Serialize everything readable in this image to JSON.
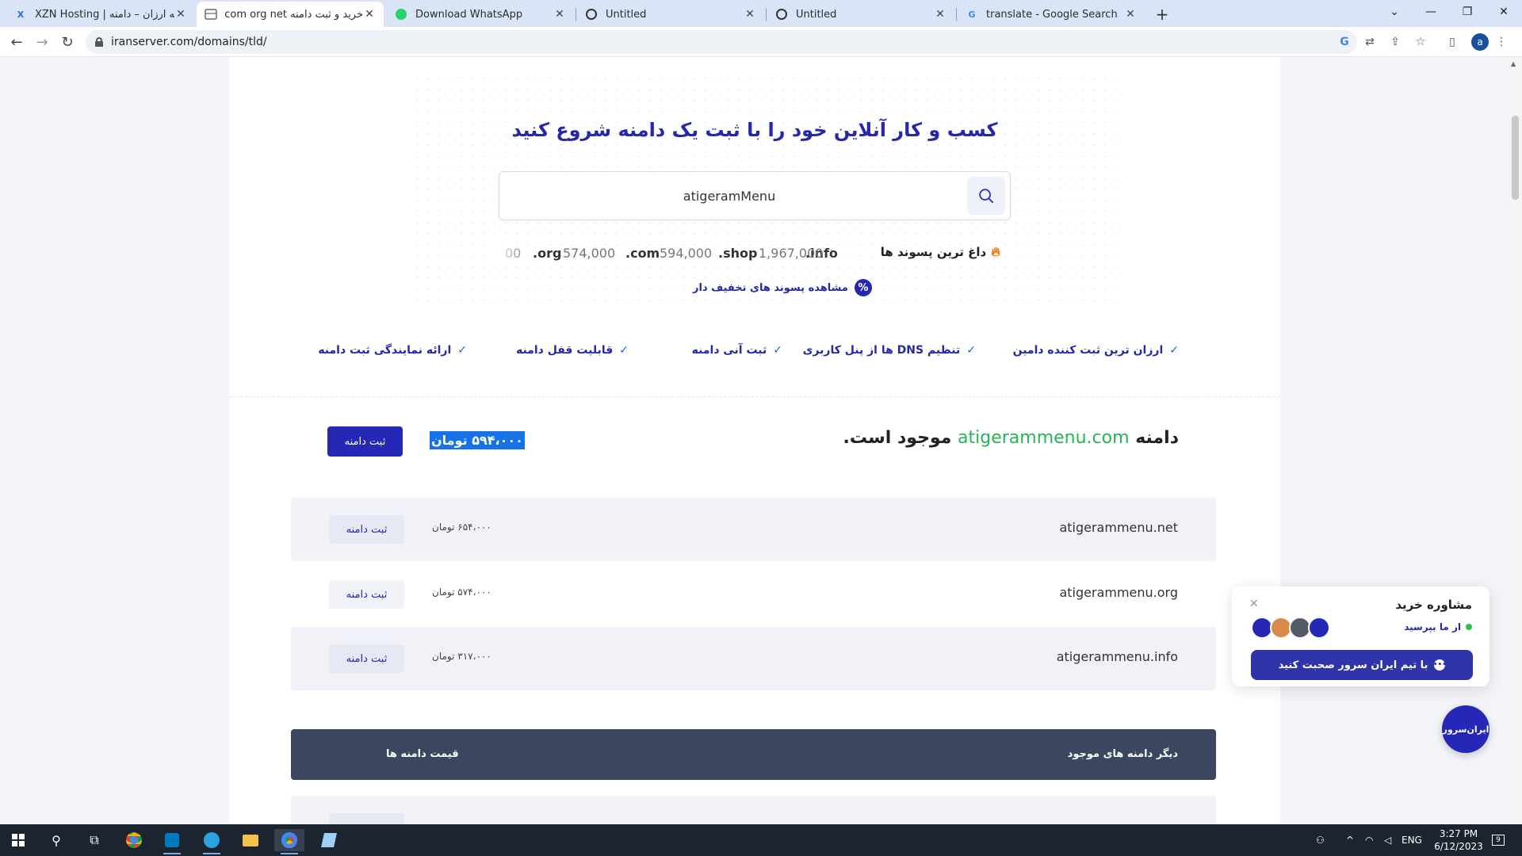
{
  "browser": {
    "tabs": [
      {
        "title": "XZN Hosting | دامنه ارزان – دامنه ...",
        "icon": "xzn-favicon"
      },
      {
        "title": "خرید و ثبت دامنه com org net و ...",
        "icon": "iranserver-favicon"
      },
      {
        "title": "Download WhatsApp",
        "icon": "whatsapp-favicon"
      },
      {
        "title": "Untitled",
        "icon": "globe-favicon"
      },
      {
        "title": "Untitled",
        "icon": "globe-favicon"
      },
      {
        "title": "translate - Google Search",
        "icon": "google-favicon"
      }
    ],
    "active_tab": 1,
    "url": "iranserver.com/domains/tld/",
    "profile_initial": "a"
  },
  "page": {
    "hero_title": "کسب و کار آنلاین خود را با ثبت یک دامنه شروع کنید",
    "search": {
      "value": "atigeramMenu",
      "placeholder": ""
    },
    "hot_tlds": {
      "label": "داغ ترین پسوند ها",
      "items": [
        {
          "tld": ".info",
          "price": ""
        },
        {
          "tld": ".shop",
          "price": "1,967,000"
        },
        {
          "tld": ".com",
          "price": "594,000"
        },
        {
          "tld": ".org",
          "price": "574,000"
        },
        {
          "tld": "",
          "price": "00"
        }
      ]
    },
    "discount_link": "مشاهده پسوند های تخفیف دار",
    "features": [
      "ارزان ترین ثبت کننده دامین",
      "تنظیم DNS ها از پنل کاربری",
      "ثبت آنی دامنه",
      "قابلیت قفل دامنه",
      "ارائه نمایندگی ثبت دامنه"
    ],
    "result": {
      "prefix": "دامنه",
      "domain": "atigerammenu.com",
      "suffix": "موجود است.",
      "price": "۵۹۴،۰۰۰ تومان",
      "button": "ثبت دامنه"
    },
    "other_domains": [
      {
        "name": "atigerammenu.net",
        "price": "۶۵۴،۰۰۰ تومان",
        "button": "ثبت دامنه"
      },
      {
        "name": "atigerammenu.org",
        "price": "۵۷۴،۰۰۰ تومان",
        "button": "ثبت دامنه"
      },
      {
        "name": "atigerammenu.info",
        "price": "۳۱۷،۰۰۰ تومان",
        "button": "ثبت دامنه"
      }
    ],
    "table_header": {
      "left": "قیمت دامنه ها",
      "right": "دیگر دامنه های موجود"
    }
  },
  "chat_widget": {
    "title": "مشاوره خرید",
    "subtitle": "از ما بپرسید",
    "button": "با تیم ایران سرور صحبت کنید",
    "logo_text": "ایران‌سرور"
  },
  "taskbar": {
    "language": "ENG",
    "time": "3:27 PM",
    "date": "6/12/2023",
    "notification_count": "9"
  }
}
